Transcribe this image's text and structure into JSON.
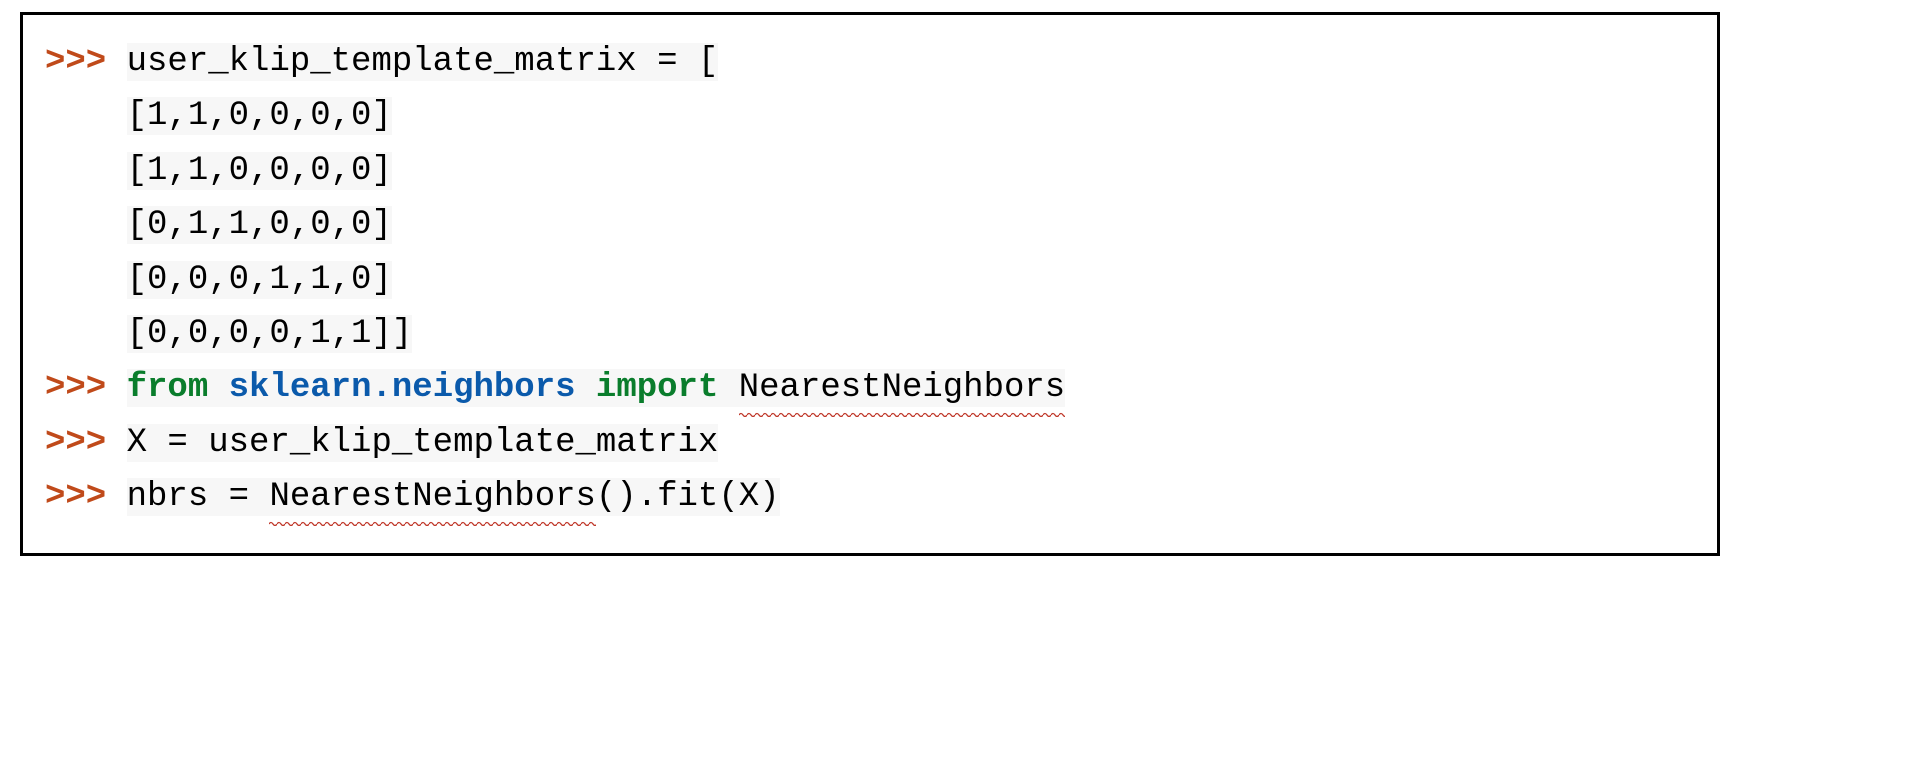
{
  "code": {
    "prompt": ">>>",
    "line1_text": "user_klip_template_matrix = [",
    "rows": [
      "[1,1,0,0,0,0]",
      "[1,1,0,0,0,0]",
      "[0,1,1,0,0,0]",
      "[0,0,0,1,1,0]",
      "[0,0,0,0,1,1]]"
    ],
    "kw_from": "from",
    "module": "sklearn.neighbors",
    "kw_import": "import",
    "import_name": "NearestNeighbors",
    "assign_X": "X = user_klip_template_matrix",
    "nbrs_prefix": "nbrs = ",
    "nbrs_call": "NearestNeighbors",
    "nbrs_suffix": "().fit(X)"
  }
}
